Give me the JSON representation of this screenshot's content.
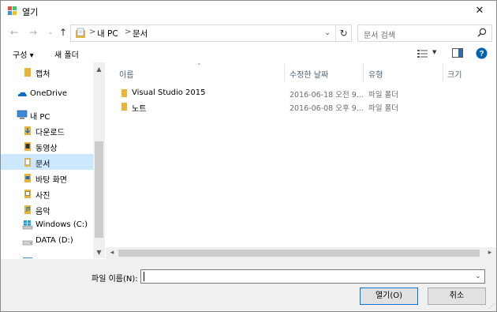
{
  "window": {
    "title": "열기",
    "close_glyph": "✕"
  },
  "nav": {
    "back_glyph": "←",
    "forward_glyph": "→",
    "recent_glyph": "⌄",
    "up_glyph": "↑",
    "breadcrumb": [
      "내 PC",
      "문서"
    ],
    "breadcrumb_sep": ">",
    "dropdown_glyph": "⌄",
    "refresh_glyph": "↻"
  },
  "search": {
    "placeholder": "문서 검색"
  },
  "toolbar": {
    "organize_label": "구성 ▾",
    "new_folder_label": "새 폴더"
  },
  "sidebar": {
    "items": [
      {
        "label": "캡처",
        "icon": "folder-icon"
      },
      {
        "label": "OneDrive",
        "icon": "onedrive-icon"
      },
      {
        "label": "내 PC",
        "icon": "computer-icon"
      },
      {
        "label": "다운로드",
        "icon": "downloads-icon"
      },
      {
        "label": "동영상",
        "icon": "videos-icon"
      },
      {
        "label": "문서",
        "icon": "documents-icon",
        "selected": true
      },
      {
        "label": "바탕 화면",
        "icon": "desktop-icon"
      },
      {
        "label": "사진",
        "icon": "pictures-icon"
      },
      {
        "label": "음악",
        "icon": "music-icon"
      },
      {
        "label": "Windows (C:)",
        "icon": "windows-drive-icon"
      },
      {
        "label": "DATA (D:)",
        "icon": "drive-icon"
      }
    ]
  },
  "columns": {
    "name": "이름",
    "modified": "수정한 날짜",
    "type": "유형",
    "size": "크기"
  },
  "files": [
    {
      "name": "Visual Studio 2015",
      "modified": "2016-06-18 오전 9...",
      "type": "파일 폴더"
    },
    {
      "name": "노트",
      "modified": "2016-06-08 오후 9...",
      "type": "파일 폴더"
    }
  ],
  "bottom": {
    "filename_label": "파일 이름(N):",
    "filename_value": "",
    "open_label": "열기(O)",
    "cancel_label": "취소"
  },
  "colors": {
    "selection": "#cce8ff",
    "accent": "#0078d7",
    "folder": "#e8b53a"
  }
}
